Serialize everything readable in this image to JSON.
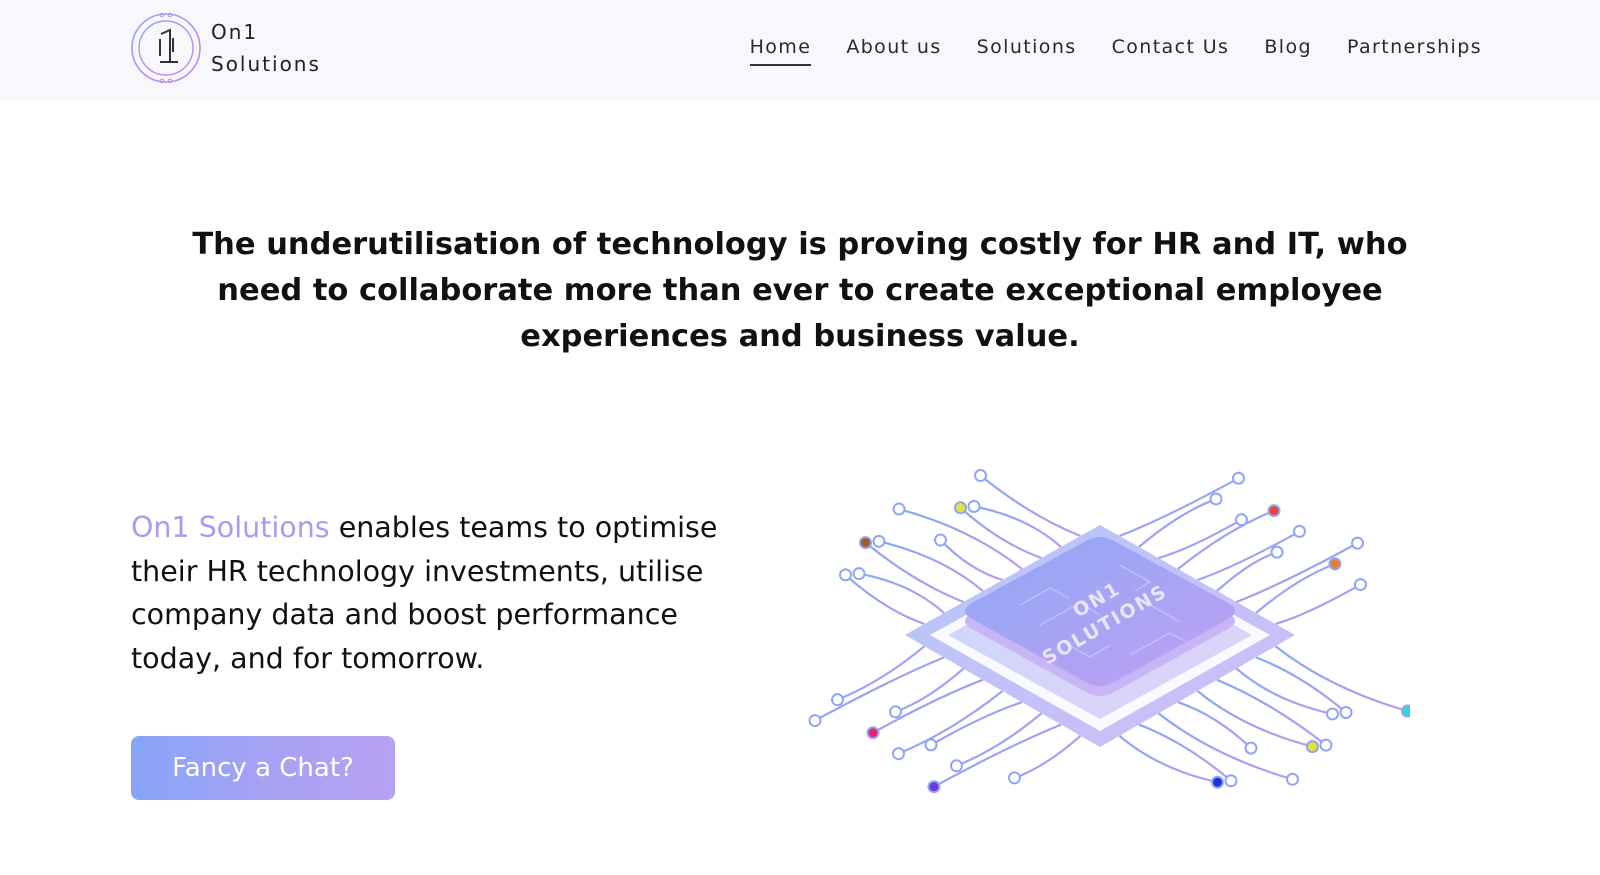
{
  "header": {
    "logo_line1": "On1",
    "logo_line2": "Solutions",
    "nav": [
      {
        "label": "Home",
        "active": true
      },
      {
        "label": "About us"
      },
      {
        "label": "Solutions"
      },
      {
        "label": "Contact Us"
      },
      {
        "label": "Blog"
      },
      {
        "label": "Partnerships"
      }
    ]
  },
  "hero": {
    "headline": "The underutilisation of technology is proving costly for HR and IT, who need to collaborate more than ever to create exceptional employee experiences and business value.",
    "intro_brand": "On1 Solutions",
    "intro_rest": " enables teams to optimise their HR technology investments, utilise company data and boost performance today, and for tomorrow.",
    "cta_label": "Fancy a Chat?"
  },
  "illustration": {
    "chip_text_line1": "ON1",
    "chip_text_line2": "SOLUTIONS"
  },
  "colors": {
    "brand": "#a99af2",
    "header_bg": "#f8f7fb",
    "circuit_blue": "#7ea3f5",
    "circuit_purple": "#b79cf2"
  }
}
